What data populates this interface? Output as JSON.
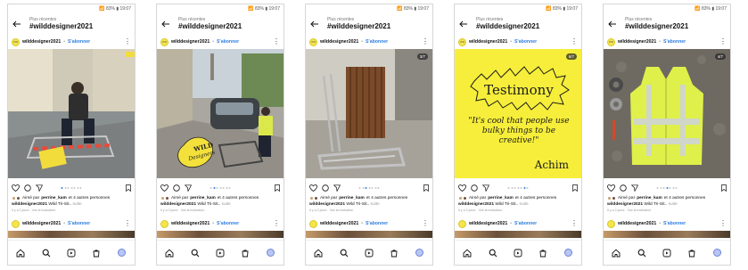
{
  "screens": [
    {
      "status": "📶 83% ▮ 19:07",
      "header_sub": "Plus récentes",
      "header_title": "#wilddesigner2021",
      "avatar_text": "WD",
      "username": "wilddesigner2021",
      "separator": "•",
      "follow": "S'abonner",
      "counter": "",
      "liked_by_prefix": "Aimé par",
      "liked_by_user": "perrine_kam",
      "liked_by_suffix": "et 4 autres personnes",
      "caption_user": "wilddesigner2021",
      "caption_text": "Wild Tri-Sit..",
      "caption_more": "suite",
      "meta": "Il y a 2 jours · Voir la traduction",
      "next_username": "wilddesigner2021",
      "next_follow": "S'abonner"
    },
    {
      "status": "📶 83% ▮ 19:07",
      "header_sub": "Plus récentes",
      "header_title": "#wilddesigner2021",
      "avatar_text": "WD",
      "username": "wilddesigner2021",
      "separator": "•",
      "follow": "S'abonner",
      "counter": "",
      "sticker_line1": "WILD",
      "sticker_line2": "Designers",
      "liked_by_prefix": "Aimé par",
      "liked_by_user": "perrine_kam",
      "liked_by_suffix": "et 4 autres personnes",
      "caption_user": "wilddesigner2021",
      "caption_text": "Wild Tri-Sit..",
      "caption_more": "suite",
      "meta": "Il y a 2 jours · Voir la traduction",
      "next_username": "wilddesigner2021",
      "next_follow": "S'abonner"
    },
    {
      "status": "📶 83% ▮ 19:07",
      "header_sub": "Plus récentes",
      "header_title": "#wilddesigner2021",
      "avatar_text": "WD",
      "username": "wilddesigner2021",
      "separator": "•",
      "follow": "S'abonner",
      "counter": "3/7",
      "liked_by_prefix": "Aimé par",
      "liked_by_user": "perrine_kam",
      "liked_by_suffix": "et 4 autres personnes",
      "caption_user": "wilddesigner2021",
      "caption_text": "Wild Tri-Sit..",
      "caption_more": "suite",
      "meta": "Il y a 2 jours · Voir la traduction",
      "next_username": "wilddesigner2021",
      "next_follow": "S'abonner"
    },
    {
      "status": "📶 83% ▮ 19:07",
      "header_sub": "Plus récentes",
      "header_title": "#wilddesigner2021",
      "avatar_text": "WD",
      "username": "wilddesigner2021",
      "separator": "•",
      "follow": "S'abonner",
      "counter": "6/7",
      "testimony_title": "Testimony",
      "testimony_quote": "\"It's cool that people use bulky things to be creative!\"",
      "testimony_author": "Achim",
      "liked_by_prefix": "Aimé par",
      "liked_by_user": "perrine_kam",
      "liked_by_suffix": "et 4 autres personnes",
      "caption_user": "wilddesigner2021",
      "caption_text": "Wild Tri-Sit..",
      "caption_more": "suite",
      "meta": "Il y a 2 jours · Voir la traduction",
      "next_username": "wilddesigner2021",
      "next_follow": "S'abonner"
    },
    {
      "status": "📶 83% ▮ 19:07",
      "header_sub": "Plus récentes",
      "header_title": "#wilddesigner2021",
      "avatar_text": "WD",
      "username": "wilddesigner2021",
      "separator": "•",
      "follow": "S'abonner",
      "counter": "4/7",
      "liked_by_prefix": "Aimé par",
      "liked_by_user": "perrine_kam",
      "liked_by_suffix": "et 4 autres personnes",
      "caption_user": "wilddesigner2021",
      "caption_text": "Wild Tri-Sit..",
      "caption_more": "suite",
      "meta": "Il y a 2 jours · Voir la traduction",
      "next_username": "wilddesigner2021",
      "next_follow": "S'abonner"
    }
  ],
  "nav_icons": [
    "home-icon",
    "search-icon",
    "reels-icon",
    "shop-icon",
    "profile-avatar"
  ],
  "colors": {
    "accent": "#2e7ee0",
    "testimony_bg": "#f6ee3a",
    "vest": "#dff04a"
  }
}
